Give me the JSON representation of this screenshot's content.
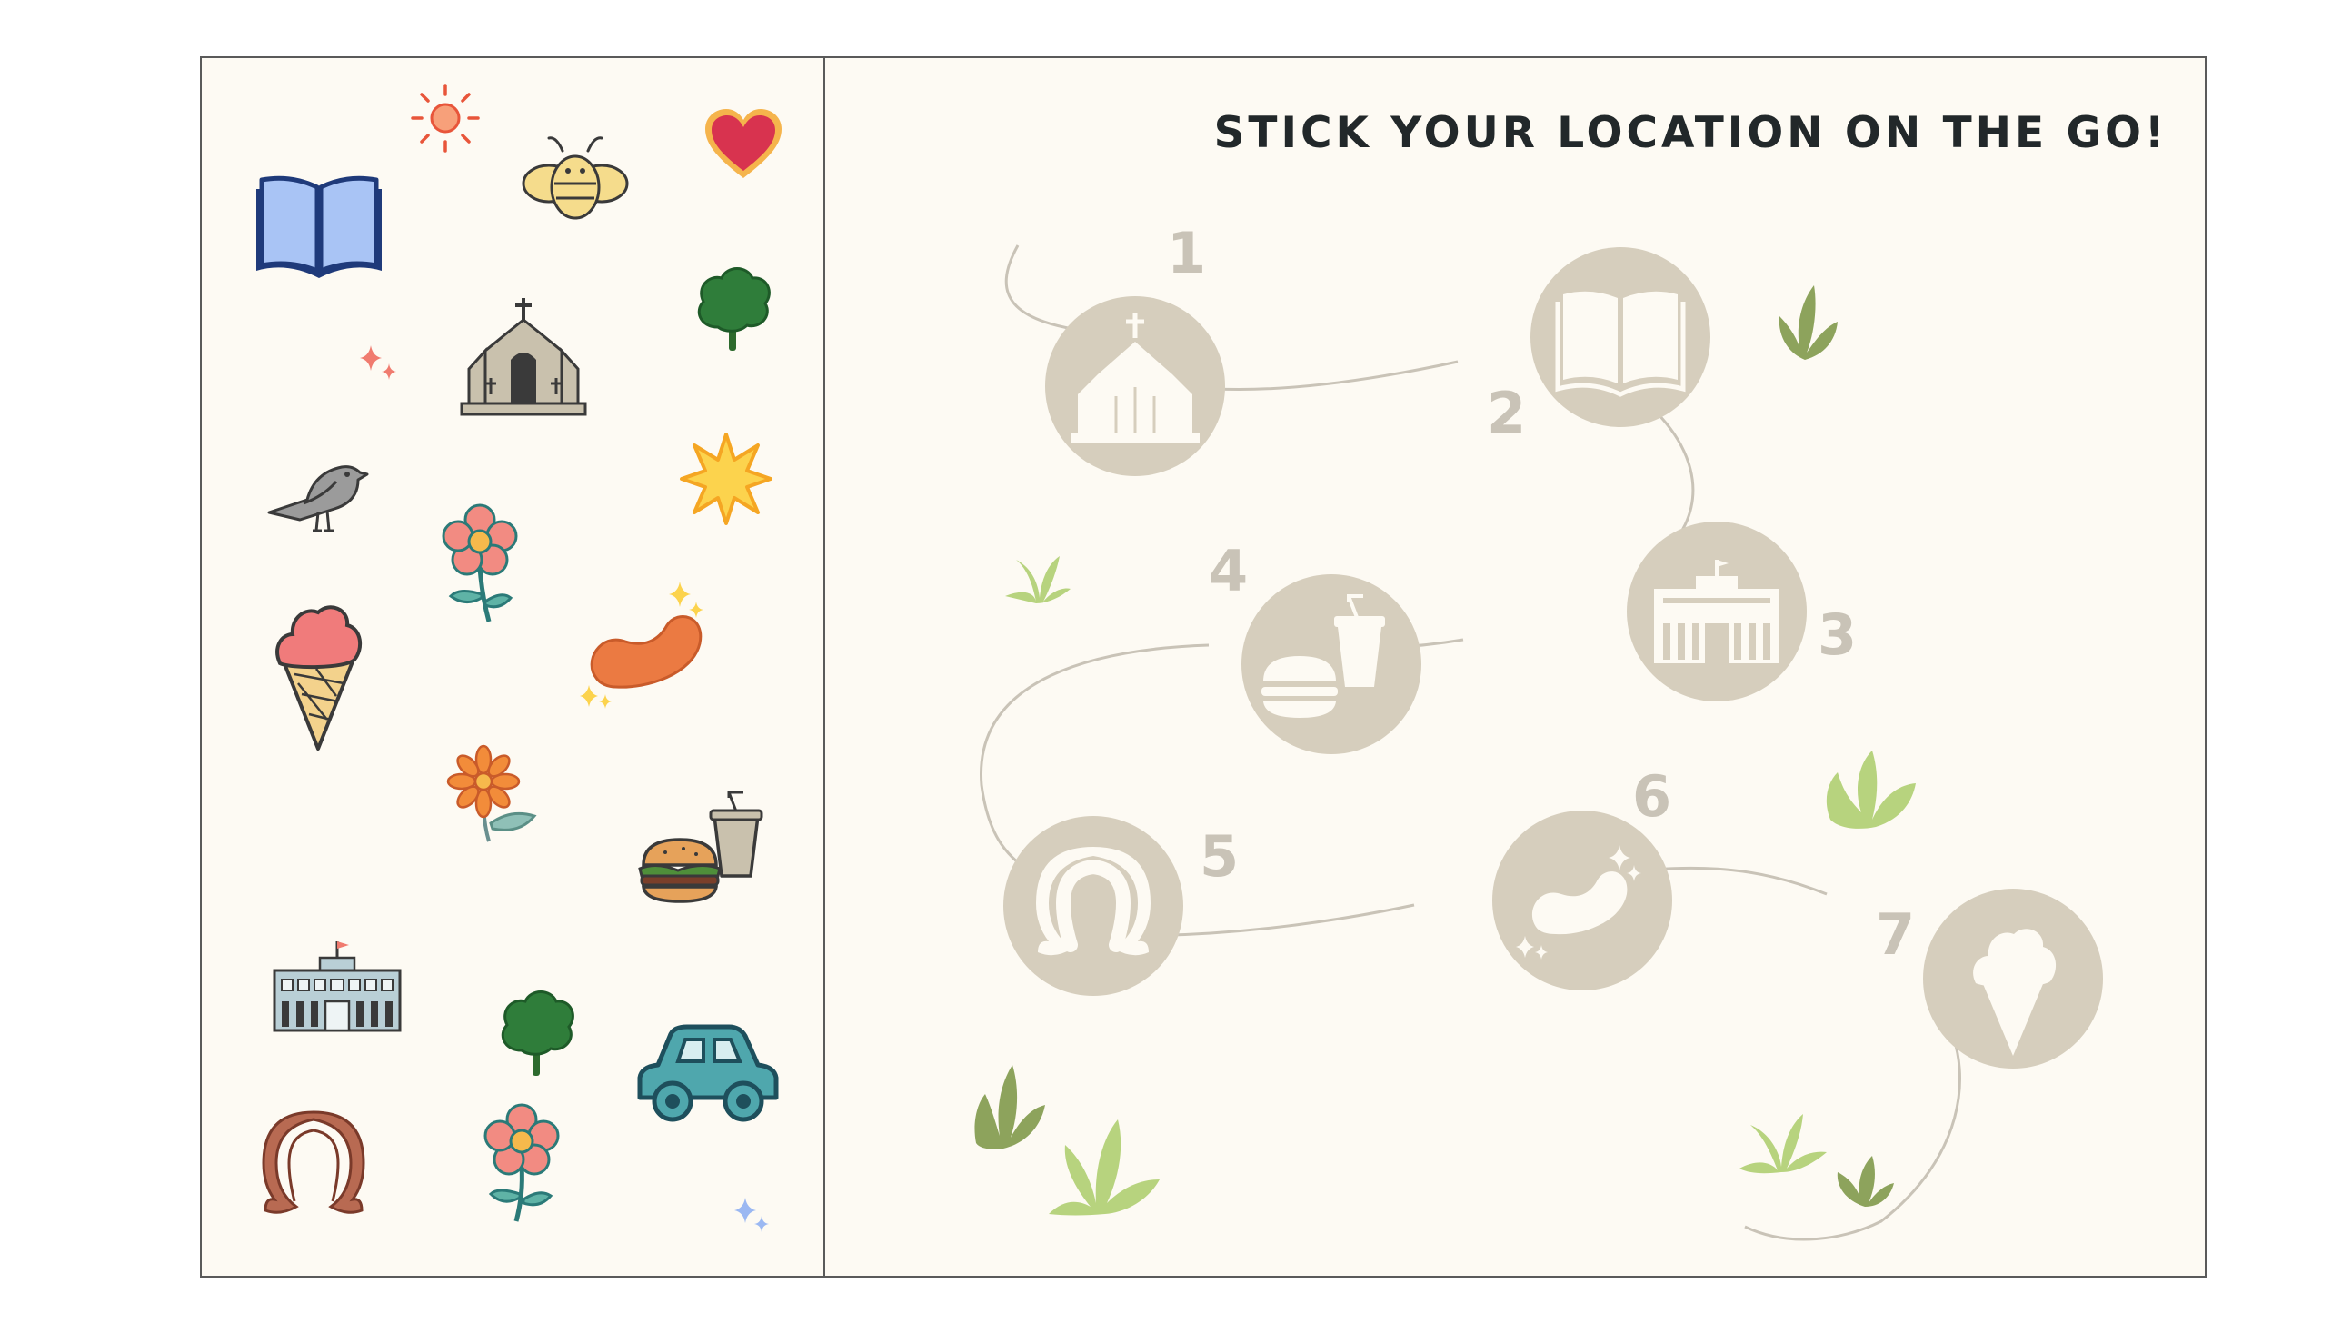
{
  "title": "STICK YOUR LOCATION ON THE GO!",
  "colors": {
    "board_bg": "#fdfaf3",
    "stop_circle": "#d6cebd",
    "stop_number": "#c9c3b7",
    "trail": "#c9c3b7",
    "title_text": "#22282a",
    "leaf_light": "#b7d37e",
    "leaf_dark": "#8da35c"
  },
  "stickers": [
    {
      "name": "book-sticker"
    },
    {
      "name": "sun-sticker"
    },
    {
      "name": "bee-sticker"
    },
    {
      "name": "heart-sticker"
    },
    {
      "name": "tree-sticker"
    },
    {
      "name": "sparkle-sticker"
    },
    {
      "name": "church-sticker"
    },
    {
      "name": "bird-sticker"
    },
    {
      "name": "starburst-sticker"
    },
    {
      "name": "flower-sticker"
    },
    {
      "name": "ice-cream-sticker"
    },
    {
      "name": "bean-sticker"
    },
    {
      "name": "orange-flower-sticker"
    },
    {
      "name": "burger-drink-sticker"
    },
    {
      "name": "building-sticker"
    },
    {
      "name": "tree-sticker"
    },
    {
      "name": "car-sticker"
    },
    {
      "name": "omega-logo-sticker"
    },
    {
      "name": "flower-sticker"
    },
    {
      "name": "blue-sparkle-sticker"
    }
  ],
  "stops": [
    {
      "number": "1",
      "icon": "church-icon"
    },
    {
      "number": "2",
      "icon": "book-icon"
    },
    {
      "number": "3",
      "icon": "building-icon"
    },
    {
      "number": "4",
      "icon": "burger-drink-icon"
    },
    {
      "number": "5",
      "icon": "omega-logo-icon"
    },
    {
      "number": "6",
      "icon": "bean-icon"
    },
    {
      "number": "7",
      "icon": "ice-cream-icon"
    }
  ]
}
